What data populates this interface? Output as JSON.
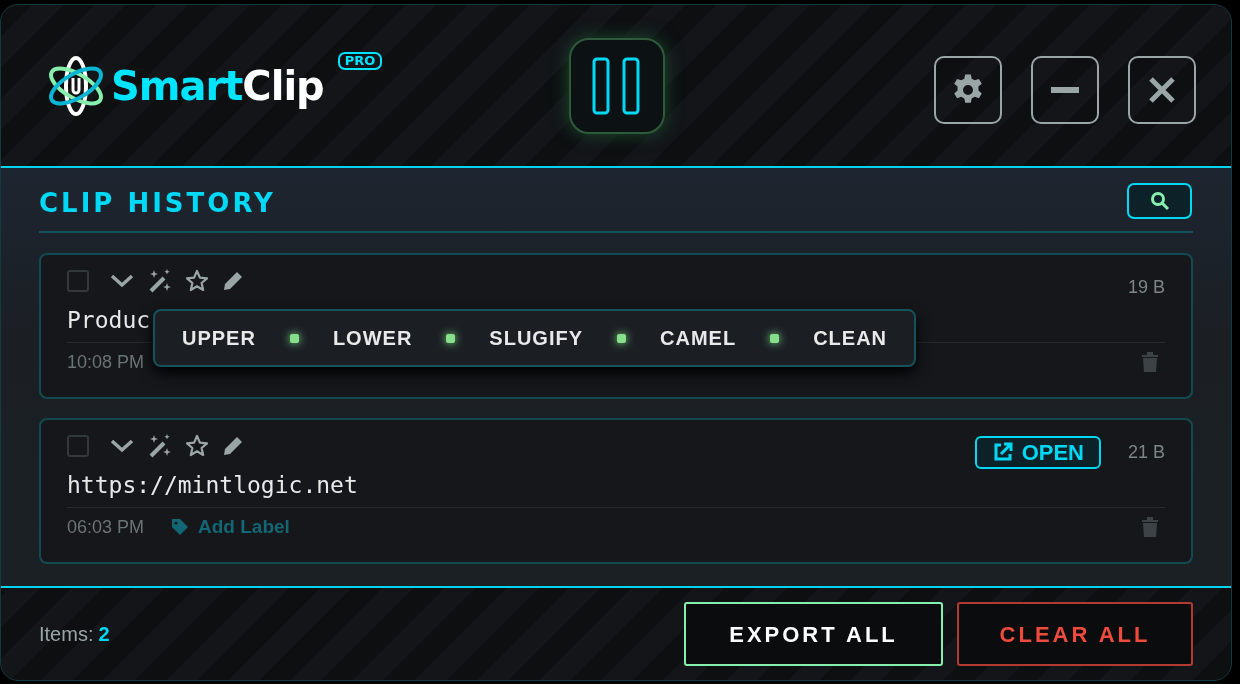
{
  "app": {
    "name_part1": "Smart",
    "name_part2": "Clip",
    "badge": "PRO"
  },
  "section": {
    "title": "CLIP HISTORY"
  },
  "clips": [
    {
      "checked": false,
      "size": "19 B",
      "content": "Produc",
      "time": "10:08 PM",
      "kind": "text",
      "transform_menu": [
        "UPPER",
        "LOWER",
        "SLUGIFY",
        "CAMEL",
        "CLEAN"
      ]
    },
    {
      "checked": false,
      "size": "21 B",
      "content": "https://mintlogic.net",
      "time": "06:03 PM",
      "kind": "url",
      "open_label": "OPEN",
      "label_action": "Add Label"
    }
  ],
  "footer": {
    "items_label": "Items:",
    "items_count": "2",
    "export": "EXPORT ALL",
    "clear": "CLEAR ALL"
  }
}
